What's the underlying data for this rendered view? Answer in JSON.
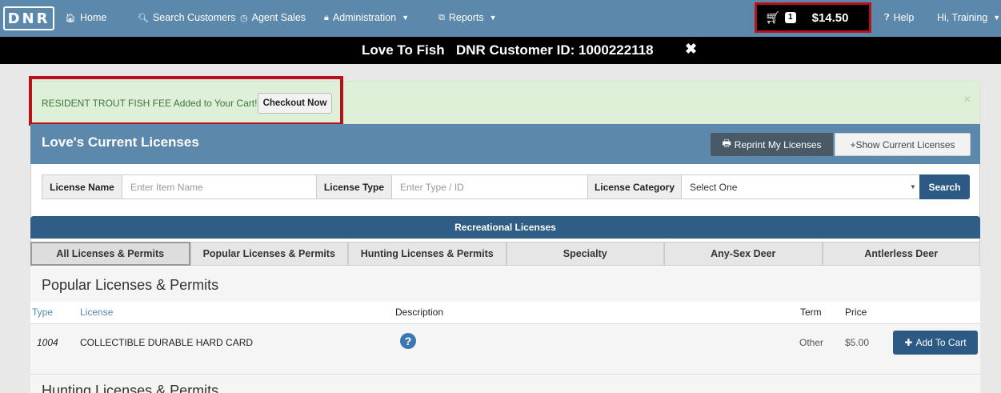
{
  "nav": {
    "logo": "DNR",
    "home": "Home",
    "search_customers": "Search Customers",
    "agent_sales": "Agent Sales",
    "administration": "Administration",
    "reports": "Reports",
    "cart_count": "1",
    "cart_total": "$14.50",
    "help": "Help",
    "user": "Hi, Training"
  },
  "customer": {
    "name": "Love To Fish",
    "id_label": "DNR Customer ID: 1000222118",
    "close": "✖"
  },
  "alert": {
    "message": "RESIDENT TROUT FISH FEE Added to Your Cart!",
    "checkout_label": "Checkout Now",
    "close": "×"
  },
  "panel": {
    "title": "Love's Current Licenses",
    "reprint_label": "Reprint My Licenses",
    "show_label": "+Show Current Licenses"
  },
  "search": {
    "license_name_label": "License Name",
    "license_name_placeholder": "Enter Item Name",
    "license_type_label": "License Type",
    "license_type_placeholder": "Enter Type / ID",
    "category_label": "License Category",
    "category_selected": "Select One",
    "search_label": "Search"
  },
  "recreational": {
    "header": "Recreational Licenses",
    "tabs": [
      "All Licenses & Permits",
      "Popular Licenses & Permits",
      "Hunting Licenses & Permits",
      "Specialty",
      "Any-Sex Deer",
      "Antlerless Deer"
    ],
    "active_tab": "All Licenses & Permits"
  },
  "section": {
    "title": "Popular Licenses & Permits",
    "columns": {
      "type": "Type",
      "license": "License",
      "description": "Description",
      "term": "Term",
      "price": "Price"
    },
    "rows": [
      {
        "type": "1004",
        "license": "COLLECTIBLE DURABLE HARD CARD",
        "term": "Other",
        "price": "$5.00",
        "add_label": "Add To Cart"
      }
    ],
    "next_title": "Hunting Licenses & Permits"
  },
  "colors": {
    "nav": "#5c88ab",
    "highlight": "#b5121b",
    "primary_button": "#2c5a85",
    "alert_bg": "#dff0d8"
  }
}
